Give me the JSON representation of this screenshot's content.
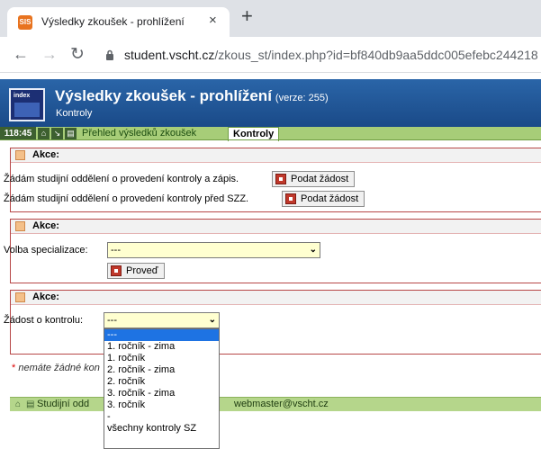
{
  "browser": {
    "tab_title": "Výsledky zkoušek - prohlížení",
    "tab_favicon": "SIS",
    "tab_close": "×",
    "new_tab": "+",
    "url_host": "student.vscht.cz",
    "url_path": "/zkous_st/index.php?id=bf840db9aa5ddc005efebc244218"
  },
  "header": {
    "logo_text": "index",
    "title": "Výsledky zkoušek - prohlížení",
    "version": "(verze: 255)",
    "subtitle": "Kontroly"
  },
  "tabbar": {
    "time": "118:45",
    "link": "Přehled výsledků zkoušek",
    "active_tab": "Kontroly"
  },
  "panel1": {
    "label": "Akce:",
    "row1_text": "Žádám studijní oddělení o provedení kontroly a zápis.",
    "row1_button": "Podat žádost",
    "row2_text": "Žádám studijní oddělení o provedení kontroly před SZZ.",
    "row2_button": "Podat žádost"
  },
  "panel2": {
    "label": "Akce:",
    "field_label": "Volba specializace:",
    "select_value": "---",
    "button": "Proveď"
  },
  "panel3": {
    "label": "Akce:",
    "field_label": "Žádost o kontrolu:",
    "select_value": "---",
    "options": [
      "---",
      "1. ročník - zima",
      "1. ročník",
      "2. ročník - zima",
      "2. ročník",
      "3. ročník - zima",
      "3. ročník",
      "-",
      "všechny kontroly SZ"
    ]
  },
  "note": {
    "star": "*",
    "text": "nemáte žádné kon"
  },
  "footer": {
    "text": "Studijní odd",
    "email": "webmaster@vscht.cz"
  }
}
